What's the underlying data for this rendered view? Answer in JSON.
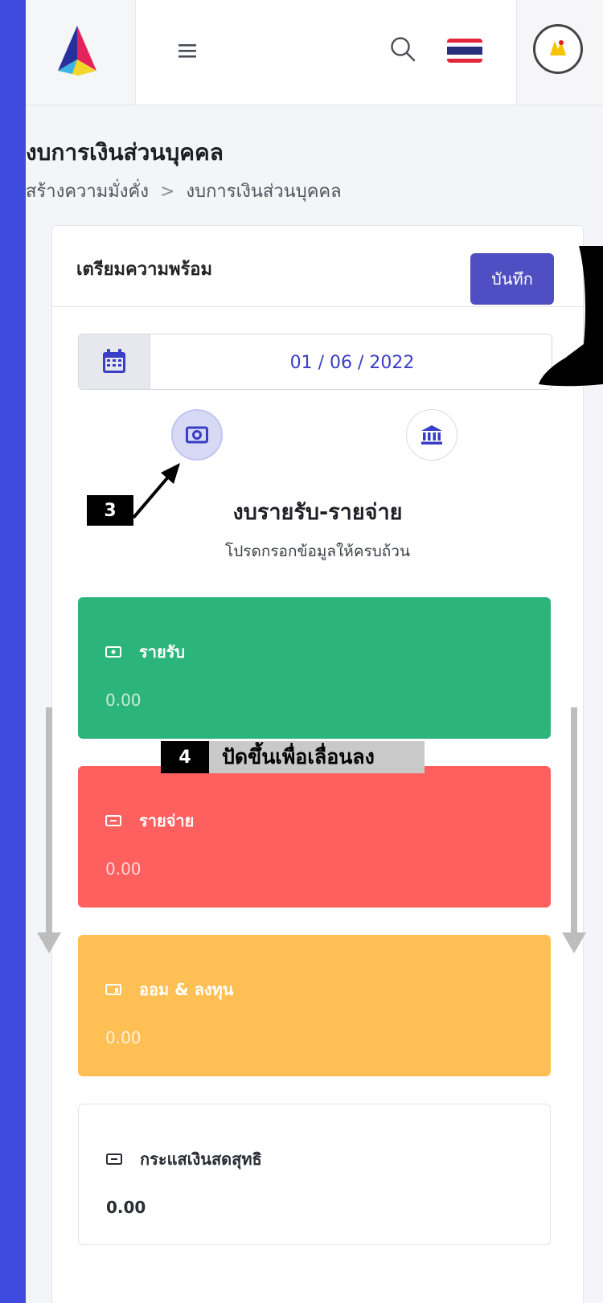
{
  "header": {
    "brand": "app-logo",
    "menu_icon": "hamburger-icon",
    "search_icon": "search-icon",
    "language_flag": "thailand-flag-icon",
    "user_avatar": "user-avatar"
  },
  "page": {
    "title": "งบการเงินส่วนบุคคล",
    "breadcrumb": [
      "สร้างความมั่งคั่ง",
      "งบการเงินส่วนบุคคล"
    ],
    "breadcrumb_separator": ">"
  },
  "card": {
    "title": "เตรียมความพร้อม",
    "save_label": "บันทึก",
    "date_value": "01 / 06 / 2022",
    "mode_buttons": [
      "cash-icon",
      "bank-icon"
    ],
    "section_title": "งบรายรับ-รายจ่าย",
    "section_subtitle": "โปรดกรอกข้อมูลให้ครบถ้วน"
  },
  "budgets": [
    {
      "label": "รายรับ",
      "value": "0.00",
      "color": "#2cb57a"
    },
    {
      "label": "รายจ่าย",
      "value": "0.00",
      "color": "#fe5f5f"
    },
    {
      "label": "ออม & ลงทุน",
      "value": "0.00",
      "color": "#fec054"
    },
    {
      "label": "กระแสเงินสดสุทธิ",
      "value": "0.00",
      "color": "#ffffff"
    }
  ],
  "annotations": {
    "step3": "3",
    "step4": "4",
    "step4_text": "ปัดขึ้นเพื่อเลื่อนลง"
  },
  "colors": {
    "background_frame": "#3f4bde",
    "primary": "#4f4ec2"
  }
}
